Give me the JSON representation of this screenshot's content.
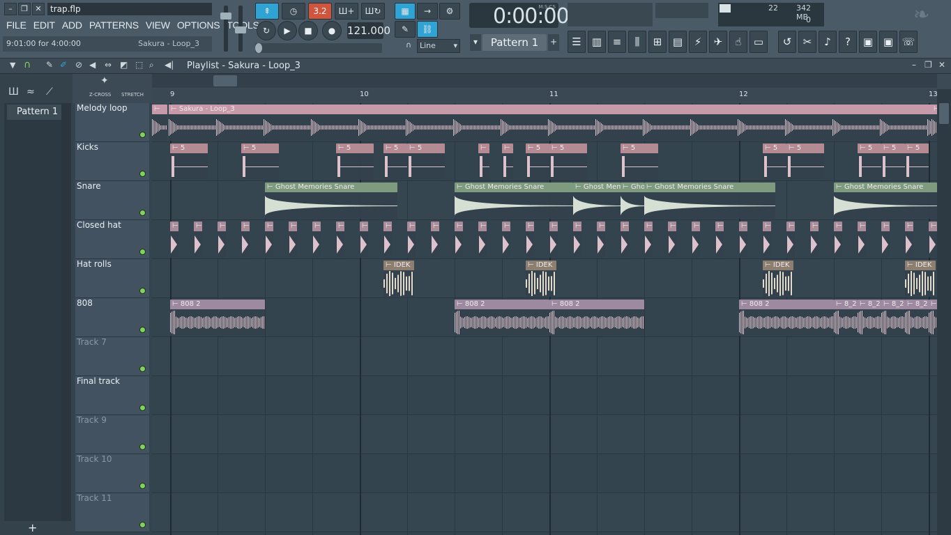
{
  "window": {
    "filename": "trap.flp"
  },
  "menu": [
    "FILE",
    "EDIT",
    "ADD",
    "PATTERNS",
    "VIEW",
    "OPTIONS",
    "TOOLS",
    "?"
  ],
  "hint": {
    "left": "9:01:00 for 4:00:00",
    "right": "Sakura - Loop_3"
  },
  "transport": {
    "tempo": "121.000",
    "time": "0:00:00",
    "time_mode": "M:S:CS",
    "snap": "Line",
    "pattern": "Pattern 1",
    "counter": "3.2"
  },
  "perf": {
    "cpu": "22",
    "ram": "342 MB",
    "polyphony": "0"
  },
  "playlist": {
    "title": "Playlist - Sakura - Loop_3",
    "zcross": "Z-CROSS",
    "stretch": "STRETCH"
  },
  "patterns": {
    "item": "Pattern 1"
  },
  "ruler": [
    "9",
    "10",
    "11",
    "12",
    "13"
  ],
  "tracks": [
    "Melody loop",
    "Kicks",
    "Snare",
    "Closed hat",
    "Hat rolls",
    "808",
    "Track 7",
    "Final track",
    "Track 9",
    "Track 10",
    "Track 11"
  ],
  "clips": {
    "melody": "Sakura - Loop_3",
    "kick": "5",
    "snare": "Ghost Memories Snare",
    "snare_short1": "Ghost Mem",
    "snare_short2": "Gho",
    "hatroll": "IDEK",
    "bass": "808 2",
    "bass_short": "8_2"
  },
  "colors": {
    "accent": "#2fa3d4",
    "melody": "#c69aa8",
    "kick": "#b48a93",
    "snare": "#7f9b7f",
    "hat": "#a98c9a",
    "hatroll": "#8c7f70",
    "bass": "#9d8aa0"
  }
}
